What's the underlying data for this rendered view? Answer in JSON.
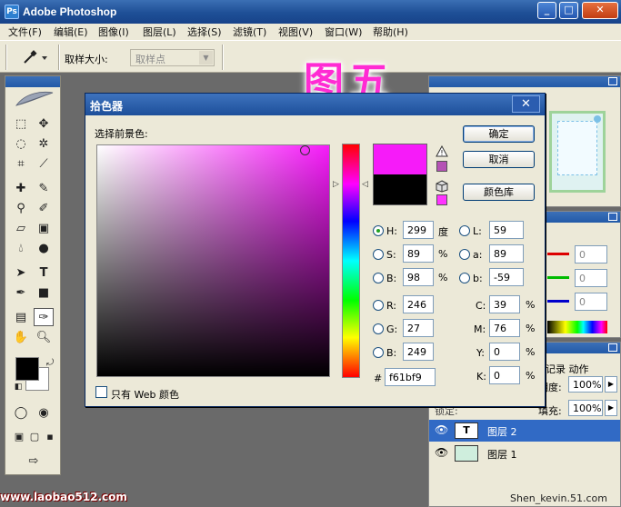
{
  "window": {
    "title": "Adobe Photoshop",
    "app_icon": "Ps"
  },
  "menu": [
    "文件(F)",
    "编辑(E)",
    "图像(I)",
    "图层(L)",
    "选择(S)",
    "滤镜(T)",
    "视图(V)",
    "窗口(W)",
    "帮助(H)"
  ],
  "options_bar": {
    "sample_size_label": "取样大小:",
    "sample_size_value": "取样点"
  },
  "annotation": "图五",
  "dialog": {
    "title": "拾色器",
    "prompt": "选择前景色:",
    "ok": "确定",
    "cancel": "取消",
    "color_libraries": "颜色库",
    "selected_color": "#f61bf9",
    "previous_color": "#000000",
    "hsb": {
      "h_label": "H:",
      "h": "299",
      "h_unit": "度",
      "s_label": "S:",
      "s": "89",
      "s_unit": "%",
      "b_label": "B:",
      "b": "98",
      "b_unit": "%"
    },
    "lab": {
      "l_label": "L:",
      "l": "59",
      "a_label": "a:",
      "a": "89",
      "b_label": "b:",
      "b": "-59"
    },
    "rgb": {
      "r_label": "R:",
      "r": "246",
      "g_label": "G:",
      "g": "27",
      "b_label": "B:",
      "b": "249"
    },
    "cmyk": {
      "c_label": "C:",
      "c": "39",
      "c_unit": "%",
      "m_label": "M:",
      "m": "76",
      "m_unit": "%",
      "y_label": "Y:",
      "y": "0",
      "y_unit": "%",
      "k_label": "K:",
      "k": "0",
      "k_unit": "%"
    },
    "hex_label": "#",
    "hex": "f61bf9",
    "web_only": "只有 Web 颜色"
  },
  "layers_panel": {
    "tabs_partial": "记录  动作",
    "opacity_label": "明度:",
    "opacity": "100%",
    "fill_label": "填充:",
    "fill": "100%",
    "lock_label": "锁定:",
    "layers": [
      {
        "name": "图层 2",
        "thumb": "T",
        "selected": true
      },
      {
        "name": "图层 1",
        "thumb": "",
        "selected": false
      }
    ]
  },
  "color_panel": {
    "r_val": "0",
    "g_val": "0",
    "b_val": "0"
  },
  "watermarks": {
    "left": "www.laobao512.com",
    "right": "Shen_kevin.51.com"
  }
}
